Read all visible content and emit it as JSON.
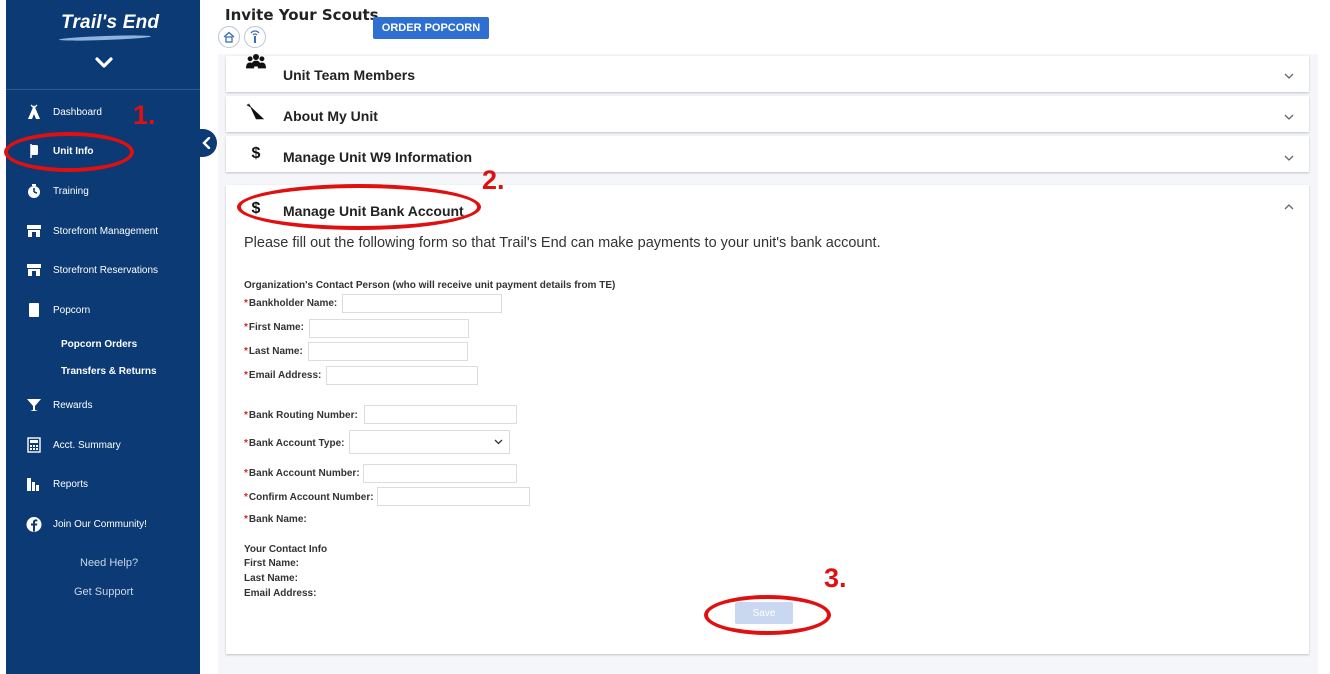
{
  "sidebar": {
    "logo": "Trail's End",
    "nav": [
      {
        "label": "Dashboard",
        "icon": "tent-icon"
      },
      {
        "label": "Unit Info",
        "icon": "flag-icon"
      },
      {
        "label": "Training",
        "icon": "training-icon"
      },
      {
        "label": "Storefront Management",
        "icon": "storefront-icon"
      },
      {
        "label": "Storefront Reservations",
        "icon": "storefront-icon"
      },
      {
        "label": "Popcorn",
        "icon": "popcorn-icon"
      },
      {
        "label": "Rewards",
        "icon": "trophy-icon"
      },
      {
        "label": "Acct. Summary",
        "icon": "calculator-icon"
      },
      {
        "label": "Reports",
        "icon": "reports-icon"
      },
      {
        "label": "Join Our Community!",
        "icon": "facebook-icon"
      }
    ],
    "popcorn_sub": [
      "Popcorn Orders",
      "Transfers & Returns"
    ],
    "help": [
      "Need Help?",
      "Get Support"
    ]
  },
  "header": {
    "title": "Invite Your Scouts",
    "order_button": "ORDER POPCORN"
  },
  "panels": [
    {
      "title": "Unit Team Members"
    },
    {
      "title": "About My Unit"
    },
    {
      "title": "Manage Unit W9 Information"
    },
    {
      "title": "Manage Unit Bank Account"
    }
  ],
  "bank_form": {
    "intro": "Please fill out the following form so that Trail's End can make payments to your unit's bank account.",
    "section_heading": "Organization's Contact Person (who will receive unit payment details from TE)",
    "required_mark": "*",
    "fields": {
      "bankholder_name": "Bankholder Name:",
      "first_name": "First Name:",
      "last_name": "Last Name:",
      "email": "Email Address:",
      "routing": "Bank Routing Number:",
      "account_type": "Bank Account Type:",
      "account_number": "Bank Account Number:",
      "confirm_account": "Confirm Account Number:",
      "bank_name": "Bank Name:"
    },
    "your_contact": {
      "heading": "Your Contact Info",
      "first_name": "First Name:",
      "last_name": "Last Name:",
      "email": "Email Address:"
    },
    "save_label": "Save"
  },
  "annotations": {
    "step1": "1.",
    "step2": "2.",
    "step3": "3."
  },
  "colors": {
    "sidebar": "#0b3a74",
    "accent": "#2e6fd1",
    "annotation": "#e01010",
    "required": "#d22222"
  }
}
